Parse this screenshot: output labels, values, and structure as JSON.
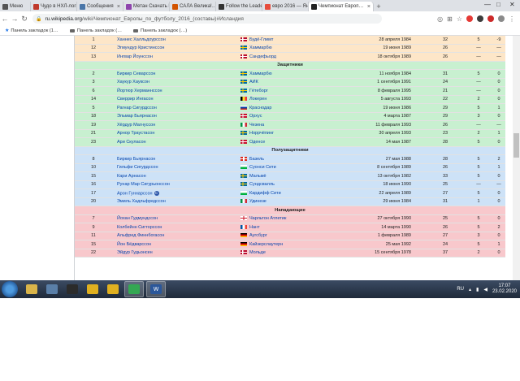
{
  "browser": {
    "tabs": [
      {
        "label": "Меню",
        "icon_color": "#555555",
        "active": false
      },
      {
        "label": "Чудо в НХЛ-логичс…",
        "icon_color": "#c0392b",
        "active": false
      },
      {
        "label": "Сообщения",
        "icon_color": "#4a76a8",
        "active": false
      },
      {
        "label": "Метан Скачать Н…",
        "icon_color": "#8e44ad",
        "active": false
      },
      {
        "label": "САЛА Велика!…",
        "icon_color": "#d35400",
        "active": false
      },
      {
        "label": "Follow the Leader…",
        "icon_color": "#333333",
        "active": false
      },
      {
        "label": "евро 2016 — Янд…",
        "icon_color": "#e74c3c",
        "active": false
      },
      {
        "label": "Чемпионат Европ…",
        "icon_color": "#222222",
        "active": true
      }
    ],
    "new_tab": "+",
    "window_controls": [
      "—",
      "□",
      "✕"
    ],
    "url": {
      "host": "ru.wikipedia.org",
      "path": "/wiki/Чемпионат_Европы_по_футболу_2016_(составы)#Исландия"
    },
    "bookmarks": [
      "Панель закладок (1…",
      "Панель закладок (…",
      "Панель закладок (…)"
    ]
  },
  "squad": {
    "sections": [
      {
        "title": "",
        "kind": "gk",
        "players": [
          {
            "num": "1",
            "name": "Ханнес Халльдоурссон",
            "club": "Будё-Глимт",
            "flag": "norway",
            "dob": "28 апреля 1984",
            "games": "32",
            "goals": "5",
            "extra": "-9"
          },
          {
            "num": "12",
            "name": "Эгмундур Кристинссон",
            "club": "Хаммарбю",
            "flag": "sweden",
            "dob": "19 июня 1989",
            "games": "26",
            "goals": "—",
            "extra": "—"
          },
          {
            "num": "13",
            "name": "Ингвар Йоунссон",
            "club": "Сандефьорд",
            "flag": "norway",
            "dob": "18 октября 1989",
            "games": "26",
            "goals": "—",
            "extra": "—"
          }
        ]
      },
      {
        "title": "Защитники",
        "kind": "df",
        "players": [
          {
            "num": "2",
            "name": "Биркир Севарссон",
            "club": "Хаммарбю",
            "flag": "sweden",
            "dob": "11 ноября 1984",
            "games": "31",
            "goals": "5",
            "extra": "0"
          },
          {
            "num": "3",
            "name": "Хаукур Хауксон",
            "club": "АИК",
            "flag": "sweden",
            "dob": "1 сентября 1991",
            "games": "24",
            "goals": "—",
            "extra": "0"
          },
          {
            "num": "6",
            "name": "Йортюр Херманнссон",
            "club": "Гётеборг",
            "flag": "sweden",
            "dob": "8 февраля 1995",
            "games": "21",
            "goals": "—",
            "extra": "0"
          },
          {
            "num": "14",
            "name": "Сверрир Ингасон",
            "club": "Локерен",
            "flag": "belgium",
            "dob": "5 августа 1993",
            "games": "22",
            "goals": "2",
            "extra": "0"
          },
          {
            "num": "5",
            "name": "Рагнар Сигурдссон",
            "club": "Краснодар",
            "flag": "russia",
            "dob": "19 июня 1986",
            "games": "29",
            "goals": "5",
            "extra": "1"
          },
          {
            "num": "18",
            "name": "Эльмар Бьярнасон",
            "club": "Орхус",
            "flag": "denmark",
            "dob": "4 марта 1987",
            "games": "29",
            "goals": "3",
            "extra": "0"
          },
          {
            "num": "19",
            "name": "Хёрдур Магнуссон",
            "club": "Чезена",
            "flag": "italy",
            "dob": "11 февраля 1993",
            "games": "26",
            "goals": "—",
            "extra": "—"
          },
          {
            "num": "21",
            "name": "Арнор Траустасон",
            "club": "Норрчёпинг",
            "flag": "sweden",
            "dob": "30 апреля 1993",
            "games": "23",
            "goals": "2",
            "extra": "1"
          },
          {
            "num": "23",
            "name": "Ари Скуласон",
            "club": "Оденсе",
            "flag": "denmark",
            "dob": "14 мая 1987",
            "games": "28",
            "goals": "5",
            "extra": "0"
          }
        ]
      },
      {
        "title": "Полузащитники",
        "kind": "mf",
        "players": [
          {
            "num": "8",
            "name": "Биркир Бьярнасон",
            "club": "Базель",
            "flag": "switzerland",
            "dob": "27 мая 1988",
            "games": "28",
            "goals": "5",
            "extra": "2"
          },
          {
            "num": "10",
            "name": "Гильфи Сигурдссон",
            "club": "Суонси Сити",
            "flag": "wales",
            "dob": "8 сентября 1989",
            "games": "26",
            "goals": "5",
            "extra": "1"
          },
          {
            "num": "15",
            "name": "Кари Арнасон",
            "club": "Мальмё",
            "flag": "sweden",
            "dob": "13 октября 1982",
            "games": "33",
            "goals": "5",
            "extra": "0"
          },
          {
            "num": "16",
            "name": "Рунар Мар Сигурьонссон",
            "club": "Сундсвалль",
            "flag": "sweden",
            "dob": "18 июня 1990",
            "games": "25",
            "goals": "—",
            "extra": "—"
          },
          {
            "num": "17",
            "name": "Арон Гуннарссон",
            "club": "Кардифф Сити",
            "flag": "wales",
            "dob": "22 апреля 1989",
            "games": "27",
            "goals": "5",
            "extra": "0",
            "captain": "C"
          },
          {
            "num": "20",
            "name": "Эмиль Хадльфредссон",
            "club": "Удинезе",
            "flag": "italy",
            "dob": "29 июня 1984",
            "games": "31",
            "goals": "1",
            "extra": "0"
          }
        ]
      },
      {
        "title": "Нападающие",
        "kind": "fw",
        "players": [
          {
            "num": "7",
            "name": "Йохан Гудмундссон",
            "club": "Чарльтон Атлетик",
            "flag": "england",
            "dob": "27 октября 1990",
            "games": "25",
            "goals": "5",
            "extra": "0"
          },
          {
            "num": "9",
            "name": "Колбейнн Сигторссон",
            "club": "Нант",
            "flag": "france",
            "dob": "14 марта 1990",
            "games": "26",
            "goals": "5",
            "extra": "2"
          },
          {
            "num": "11",
            "name": "Альфред Финнбогасон",
            "club": "Аугсбург",
            "flag": "germany",
            "dob": "1 февраля 1989",
            "games": "27",
            "goals": "3",
            "extra": "0"
          },
          {
            "num": "15",
            "name": "Йон Бёдварссон",
            "club": "Кайзерслаутерн",
            "flag": "germany",
            "dob": "25 мая 1992",
            "games": "24",
            "goals": "5",
            "extra": "1"
          },
          {
            "num": "22",
            "name": "Эйдур Гудьонсен",
            "club": "Мольде",
            "flag": "norway",
            "dob": "15 сентября 1978",
            "games": "37",
            "goals": "2",
            "extra": "0"
          }
        ]
      }
    ]
  },
  "taskbar": {
    "icons": [
      {
        "name": "explorer-taskbar-icon",
        "color": "#d9b44a",
        "label": ""
      },
      {
        "name": "media-taskbar-icon",
        "color": "#5a7fa8",
        "label": ""
      },
      {
        "name": "olympic-taskbar-icon",
        "color": "#2b2b2b",
        "label": ""
      },
      {
        "name": "app-taskbar-icon-1",
        "color": "#e0b020",
        "label": ""
      },
      {
        "name": "app-taskbar-icon-2",
        "color": "#e0b020",
        "label": ""
      },
      {
        "name": "chrome-taskbar-icon",
        "color": "#34a853",
        "label": ""
      },
      {
        "name": "word-taskbar-icon",
        "color": "#2b579a",
        "label": "W"
      }
    ],
    "language": "RU",
    "time": "17:07",
    "date": "23.02.2020"
  }
}
